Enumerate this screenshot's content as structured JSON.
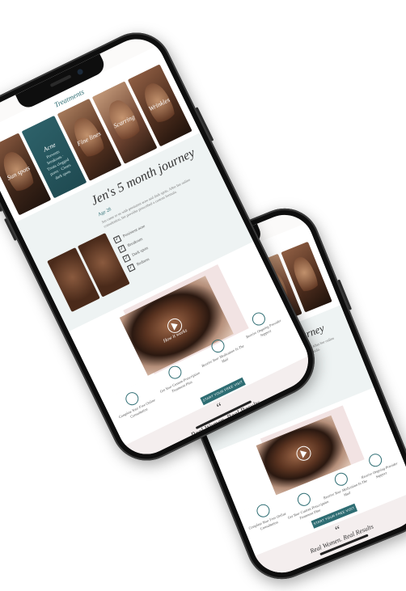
{
  "hero": {
    "top_label": "Treatments",
    "tiles": [
      {
        "label": "Sun spots",
        "sub": ""
      },
      {
        "label": "Acne",
        "sub": "Prevents breakouts · Treats clogged pores · Clears dark spots"
      },
      {
        "label": "Fine lines",
        "sub": ""
      },
      {
        "label": "Scarring",
        "sub": ""
      },
      {
        "label": "Wrinkles",
        "sub": ""
      }
    ]
  },
  "journey": {
    "title": "Jen's 5 month journey",
    "tag": "Age 28",
    "text": "Jen came to us with persistent acne and dark spots. After her online consultation, her provider prescribed a custom formula.",
    "checks": [
      "Persistent acne",
      "Breakouts",
      "Dark spots",
      "Redness"
    ]
  },
  "feature": {
    "label": "How it works"
  },
  "steps": [
    "Complete Your Free Online Consultation",
    "Get Your Custom Prescription Treatment Plan",
    "Receive Your Medication In The Mail",
    "Receive Ongoing Provider Support"
  ],
  "cta": {
    "label": "START YOUR FREE VISIT"
  },
  "quote": {
    "mark": "“",
    "text": "Real Women. Real Results"
  },
  "colors": {
    "accent": "#2e6d73",
    "phone": "#0e0e0e"
  }
}
